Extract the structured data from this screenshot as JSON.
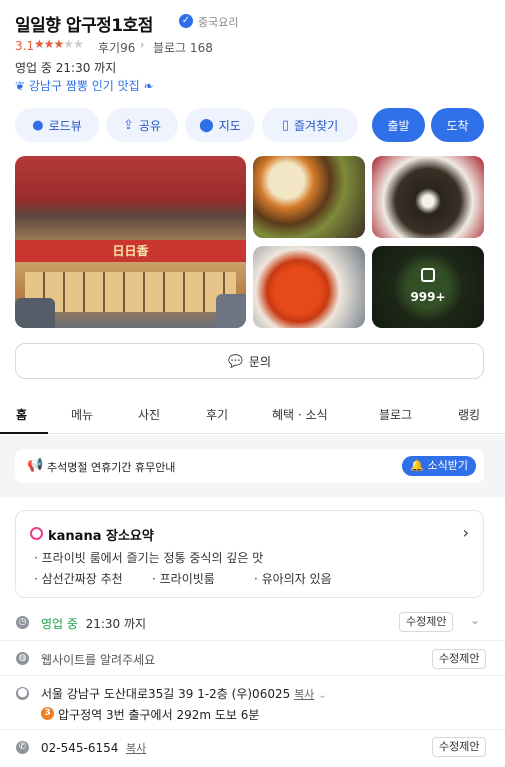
{
  "place": {
    "name": "일일향 압구정1호점",
    "category": "중국요리",
    "rating": "3.1",
    "stars_filled": 3,
    "stars_total": 5,
    "reviews_label": "후기96",
    "blog_label": "블로그 168",
    "open_status": "영업 중",
    "open_until": "21:30 까지",
    "tag": "강남구 짬뽕 인기 맛집"
  },
  "actions": {
    "roadview": "로드뷰",
    "share": "공유",
    "map": "지도",
    "favorite": "즐겨찾기",
    "depart": "출발",
    "arrive": "도착"
  },
  "photos": {
    "sign_text": "日日香",
    "more_count": "999+"
  },
  "inquiry_label": "문의",
  "tabs": [
    "홈",
    "메뉴",
    "사진",
    "후기",
    "혜택 · 소식",
    "블로그",
    "랭킹"
  ],
  "notice": {
    "text": "추석명절 연휴기간 휴무안내",
    "subscribe": "소식받기"
  },
  "summary": {
    "brand": "kanana 장소요약",
    "bullet1": "· 프라이빗 룸에서 즐기는 정통 중식의 깊은 맛",
    "bullet2": "· 삼선간짜장 추천",
    "bullet3": "· 프라이빗룸",
    "bullet4": "· 유아의자 있음"
  },
  "info": {
    "hours_status": "영업 중",
    "hours_until": "21:30 까지",
    "website_prompt": "웹사이트를 알려주세요",
    "address": "서울 강남구 도산대로35길 39 1-2층 (우)06025",
    "station_line": "3",
    "station_text": "압구정역 3번 출구에서 292m  도보 6분",
    "phone": "02-545-6154",
    "copy_label": "복사",
    "edit_label": "수정제안"
  },
  "colors": {
    "accent": "#2f6fe8",
    "rating": "#e45a3a",
    "open_green": "#1aa34a",
    "kanana": "#ec3b8a",
    "line3": "#f07f23"
  }
}
